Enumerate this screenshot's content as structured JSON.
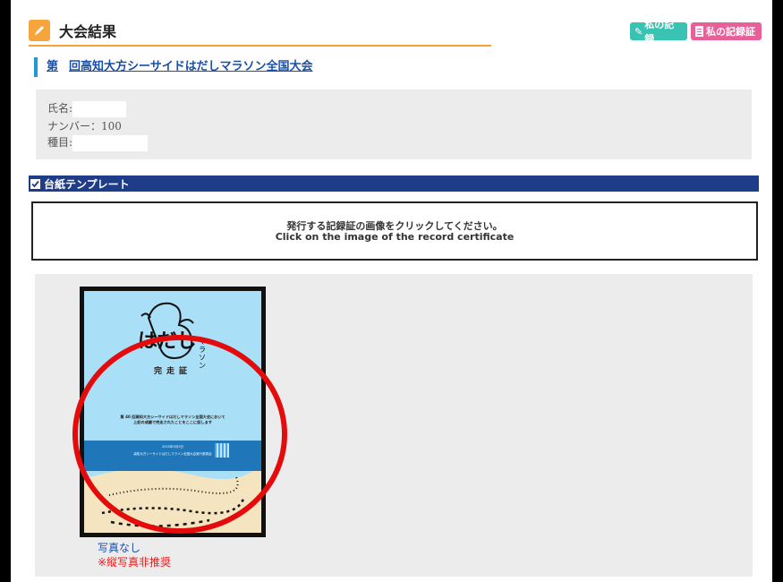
{
  "header": {
    "title": "大会結果",
    "my_record_label": "私の記録",
    "my_certificate_label": "私の記録証"
  },
  "event": {
    "prefix": "第",
    "name": "回高知大方シーサイドはだしマラソン全国大会"
  },
  "info": {
    "name_label": "氏名",
    "name_value": "",
    "number_label": "ナンバー",
    "number_value": "100",
    "category_label": "種目",
    "category_value": ""
  },
  "section": {
    "title": "台紙テンプレート"
  },
  "instruction": {
    "jp": "発行する記録証の画像をクリックしてください。",
    "en": "Click on the image of the record certificate"
  },
  "certificate": {
    "logo_main": "はだし",
    "logo_sub": "マラソン",
    "title": "完走証",
    "body_line1": "第 40 回高知大方シーサイドはだしマラソン全国大会において",
    "body_line2": "上記の成績で完走されたことをここに証します",
    "date": "2025年5月3日",
    "organizer": "高知大方シーサイドはだしマラソン全国大会実行委員会"
  },
  "gallery": {
    "no_photo": "写真なし",
    "warning": "※縦写真非推奨"
  },
  "colors": {
    "accent_orange": "#f5a53b",
    "teal_button": "#39c3b3",
    "pink_button": "#e8609a",
    "section_navy": "#1f3c88",
    "link_blue": "#1a4fa8",
    "highlight_red": "#e30b0b"
  }
}
